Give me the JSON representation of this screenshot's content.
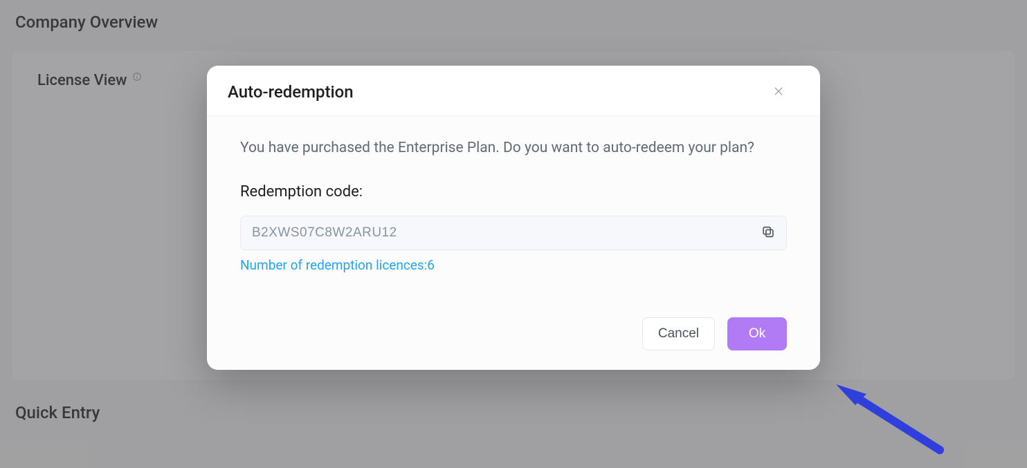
{
  "page": {
    "company_overview_title": "Company Overview",
    "license_view_title": "License View",
    "quick_entry_title": "Quick Entry"
  },
  "modal": {
    "title": "Auto-redemption",
    "message": "You have purchased the Enterprise Plan. Do you want to auto-redeem your plan?",
    "code_label": "Redemption code:",
    "code_value": "B2XWS07C8W2ARU12",
    "licences_hint": "Number of redemption licences:6",
    "cancel_label": "Cancel",
    "ok_label": "Ok"
  }
}
